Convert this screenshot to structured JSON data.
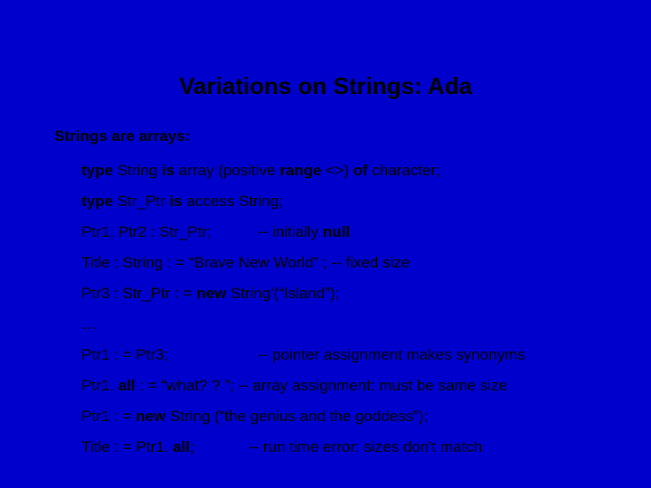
{
  "title": "Variations on Strings: Ada",
  "subheading": "Strings are arrays:",
  "lines": {
    "l1_p1": "type",
    "l1_p2": " String ",
    "l1_p3": "is",
    "l1_p4": " array (positive ",
    "l1_p5": "range",
    "l1_p6": " <>) ",
    "l1_p7": "of",
    "l1_p8": " character;",
    "l2_p1": "type",
    "l2_p2": " Str_Ptr ",
    "l2_p3": "is",
    "l2_p4": " access String;",
    "l3_p1": "Ptr1, Ptr2 : Str_Ptr;",
    "l3_p2": "--  initially ",
    "l3_p3": "null",
    "l4": "Title : String : = “Brave New World” ;   -- fixed size",
    "l5_p1": "Ptr3 : Str_Ptr : = ",
    "l5_p2": "new",
    "l5_p3": " String'(“Island”);",
    "l6": "…",
    "l7_p1": "Ptr1 : = Ptr3;",
    "l7_p2": "-- pointer assignment makes synonyms",
    "l8_p1": "Ptr1. ",
    "l8_p2": "all",
    "l8_p3": " : = “what? ? ”;   -- array assignment: must be same size",
    "l9_p1": "Ptr1 : = ",
    "l9_p2": "new",
    "l9_p3": " String (“the genius and the goddess”);",
    "l10_p1": "Title : = Ptr1. ",
    "l10_p2": "all",
    "l10_p3": ";",
    "l10_p4": "-- run time error: sizes don't match"
  }
}
